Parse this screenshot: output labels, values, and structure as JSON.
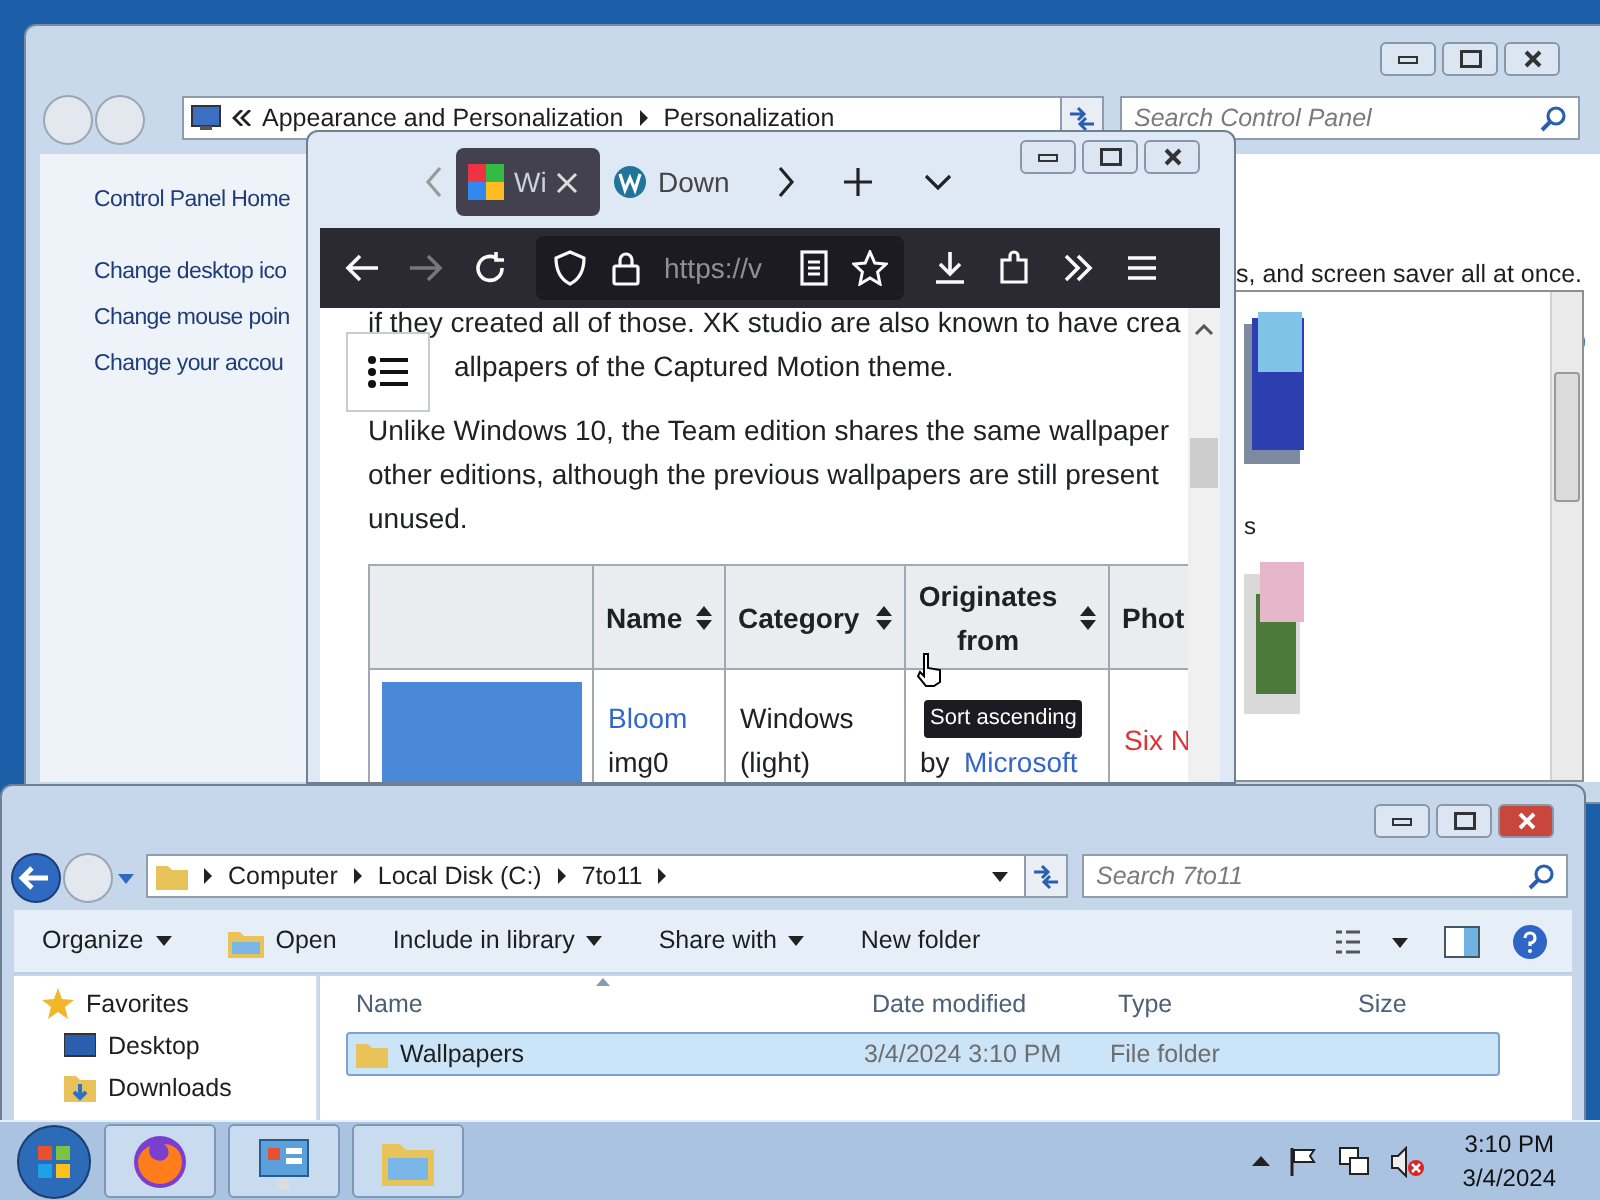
{
  "control_panel": {
    "breadcrumb": [
      "Appearance and Personalization",
      "Personalization"
    ],
    "search": {
      "placeholder": "Search Control Panel"
    },
    "sidebar_links": [
      "Control Panel Home",
      "Change desktop ico",
      "Change mouse poin",
      "Change your accou"
    ],
    "intro_text": "s, and screen saver all at once.",
    "side_letter": "s"
  },
  "browser": {
    "tabs": [
      {
        "label": "Wi",
        "selected": true
      },
      {
        "label": "Down",
        "selected": false
      }
    ],
    "url": "https://v",
    "paragraphs": [
      [
        "if they created all of those. XK studio are also known to have crea",
        "allpapers of the Captured Motion theme."
      ],
      [
        "Unlike Windows 10, the Team edition shares the same wallpaper",
        "other editions, although the previous wallpapers are still present",
        "unused."
      ]
    ],
    "table": {
      "columns": [
        "",
        "Name",
        "Category",
        "Originates from",
        "Phot"
      ],
      "row": {
        "name_link": "Bloom",
        "name_file": "img0",
        "category": "Windows (light)",
        "origin_prefix": "by",
        "origin_link": "Microsoft",
        "photo_link": "Six N"
      }
    },
    "tooltip": "Sort ascending"
  },
  "explorer": {
    "breadcrumb": [
      "Computer",
      "Local Disk (C:)",
      "7to11"
    ],
    "search": {
      "placeholder": "Search 7to11"
    },
    "toolbar": [
      "Organize",
      "Open",
      "Include in library",
      "Share with",
      "New folder"
    ],
    "nav": [
      {
        "label": "Favorites",
        "kind": "star"
      },
      {
        "label": "Desktop",
        "kind": "desktop"
      },
      {
        "label": "Downloads",
        "kind": "folder"
      }
    ],
    "columns": [
      "Name",
      "Date modified",
      "Type",
      "Size"
    ],
    "rows": [
      {
        "name": "Wallpapers",
        "date": "3/4/2024 3:10 PM",
        "type": "File folder",
        "selected": true
      }
    ]
  },
  "taskbar": {
    "time": "3:10 PM",
    "date": "3/4/2024"
  }
}
